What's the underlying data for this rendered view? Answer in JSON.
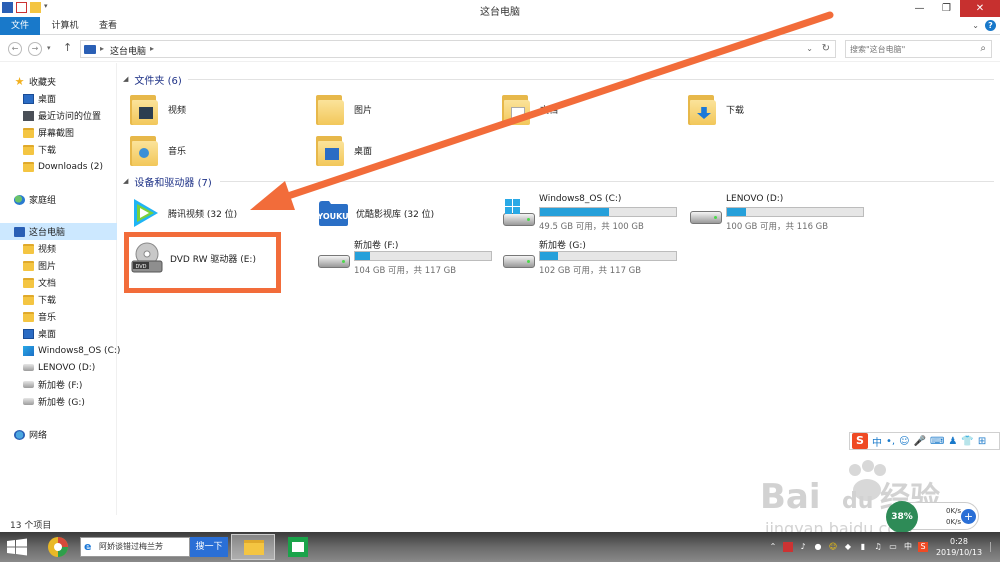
{
  "window": {
    "title": "这台电脑"
  },
  "ribbon": {
    "tabs": [
      {
        "label": "文件"
      },
      {
        "label": "计算机"
      },
      {
        "label": "查看"
      }
    ]
  },
  "address": {
    "crumb": "这台电脑",
    "search_placeholder": "搜索\"这台电脑\""
  },
  "sidebar": {
    "items": [
      {
        "label": "收藏夹",
        "icon": "star-icon"
      },
      {
        "label": "桌面",
        "icon": "desktop-icon"
      },
      {
        "label": "最近访问的位置",
        "icon": "recent-icon"
      },
      {
        "label": "屏幕截图",
        "icon": "folder-icon"
      },
      {
        "label": "下载",
        "icon": "download-folder-icon"
      },
      {
        "label": "Downloads (2)",
        "icon": "folder-icon"
      },
      {
        "label": "家庭组",
        "icon": "homegroup-icon"
      },
      {
        "label": "这台电脑",
        "icon": "computer-icon"
      },
      {
        "label": "视频",
        "icon": "folder-icon"
      },
      {
        "label": "图片",
        "icon": "folder-icon"
      },
      {
        "label": "文档",
        "icon": "folder-icon"
      },
      {
        "label": "下载",
        "icon": "download-folder-icon"
      },
      {
        "label": "音乐",
        "icon": "folder-icon"
      },
      {
        "label": "桌面",
        "icon": "desktop-icon"
      },
      {
        "label": "Windows8_OS (C:)",
        "icon": "windows-drive-icon"
      },
      {
        "label": "LENOVO (D:)",
        "icon": "drive-icon"
      },
      {
        "label": "新加卷 (F:)",
        "icon": "drive-icon"
      },
      {
        "label": "新加卷 (G:)",
        "icon": "drive-icon"
      },
      {
        "label": "网络",
        "icon": "network-icon"
      }
    ]
  },
  "folders": {
    "header": "文件夹 (6)",
    "items": [
      {
        "label": "视频"
      },
      {
        "label": "图片"
      },
      {
        "label": "文档"
      },
      {
        "label": "下载"
      },
      {
        "label": "音乐"
      },
      {
        "label": "桌面"
      }
    ]
  },
  "devices": {
    "header": "设备和驱动器 (7)",
    "tencent": "腾讯视频 (32 位)",
    "youku": "优酷影视库 (32 位)",
    "dvd": "DVD RW 驱动器 (E:)",
    "drives": [
      {
        "name": "Windows8_OS (C:)",
        "free": "49.5 GB 可用，共 100 GB",
        "used_fraction": 0.505
      },
      {
        "name": "LENOVO (D:)",
        "free": "100 GB 可用，共 116 GB",
        "used_fraction": 0.14
      },
      {
        "name": "新加卷 (F:)",
        "free": "104 GB 可用，共 117 GB",
        "used_fraction": 0.11
      },
      {
        "name": "新加卷 (G:)",
        "free": "102 GB 可用，共 117 GB",
        "used_fraction": 0.13
      }
    ]
  },
  "status": {
    "count": "13 个项目"
  },
  "ime": {
    "logo": "S",
    "mode": "中"
  },
  "speed": {
    "percent": "38%",
    "up": "0K/s",
    "down": "0K/s"
  },
  "watermark": {
    "text1": "Bai",
    "text2": "du",
    "text3": "经验",
    "url": "jingyan.baidu.com"
  },
  "taskbar": {
    "search_text": "阿娇谈错过梅兰芳",
    "search_button": "搜一下",
    "ime": "中",
    "time": "0:28",
    "date": "2019/10/13"
  },
  "colors": {
    "accent": "#1979ca",
    "highlight": "#f26c3a",
    "drive_bar": "#26a0da"
  }
}
